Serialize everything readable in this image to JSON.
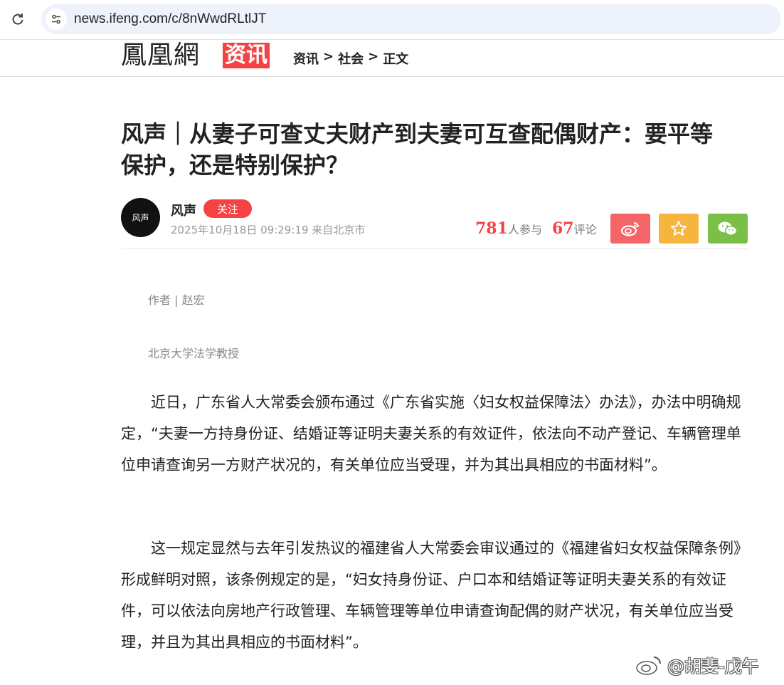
{
  "browser": {
    "url": "news.ifeng.com/c/8nWwdRLtlJT"
  },
  "header": {
    "logo_text": "鳳凰網",
    "logo_badge": "资讯",
    "breadcrumb": [
      "资讯",
      ">",
      "社会",
      ">",
      "正文"
    ]
  },
  "article": {
    "title": "风声｜从妻子可查丈夫财产到夫妻可互查配偶财产：要平等保护，还是特别保护？",
    "author": {
      "avatar_text": "风声",
      "name": "风声",
      "follow_label": "关注",
      "meta": "2025年10月18日 09:29:19 来自北京市"
    },
    "stats": {
      "participants": "781",
      "participants_label": "人参与",
      "comments": "67",
      "comments_label": "评论"
    },
    "byline": {
      "author_line": "作者 | 赵宏",
      "affiliation": "北京大学法学教授"
    },
    "paragraphs": [
      "近日，广东省人大常委会颁布通过《广东省实施〈妇女权益保障法〉办法》，办法中明确规定，“夫妻一方持身份证、结婚证等证明夫妻关系的有效证件，依法向不动产登记、车辆管理单位申请查询另一方财产状况的，有关单位应当受理，并为其出具相应的书面材料”。",
      "这一规定显然与去年引发热议的福建省人大常委会审议通过的《福建省妇女权益保障条例》形成鲜明对照，该条例规定的是，“妇女持身份证、户口本和结婚证等证明夫妻关系的有效证件，可以依法向房地产行政管理、车辆管理等单位申请查询配偶的财产状况，有关单位应当受理，并且为其出具相应的书面材料”。"
    ]
  },
  "watermark": "@胡斐-戊午",
  "colors": {
    "accent": "#f54343",
    "weibo": "#f56467",
    "favorite": "#f6b53f",
    "wechat": "#7ac046"
  },
  "icons": [
    "reload-icon",
    "site-info-icon",
    "weibo-icon",
    "star-icon",
    "wechat-icon"
  ]
}
